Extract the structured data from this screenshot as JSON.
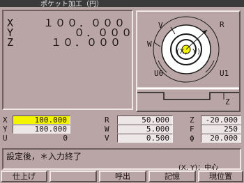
{
  "title": "ポケット加工（円）",
  "position": {
    "x_label": "X",
    "x_value": "１００．０００",
    "y_label": "Y",
    "y_value": "    ０．０００",
    "z_label": "Z",
    "z_value": " １０．０００"
  },
  "diagram": {
    "v_label": "V",
    "r_label": "R",
    "w_label": "W",
    "u0_label": "U0",
    "u1_label": "U1",
    "z_label": "Z",
    "center_label": "(X, Y)"
  },
  "params": {
    "x": {
      "label": "X",
      "value": "100.000"
    },
    "y": {
      "label": "Y",
      "value": "100.000"
    },
    "u": {
      "label": "U",
      "value": "0"
    },
    "r": {
      "label": "R",
      "value": "50.000"
    },
    "w": {
      "label": "W",
      "value": "5.000"
    },
    "v": {
      "label": "V",
      "value": "0.500"
    },
    "z": {
      "label": "Z",
      "value": "-20.000"
    },
    "f": {
      "label": "F",
      "value": "250"
    },
    "phi": {
      "label": "ϕ",
      "value": "20.000"
    }
  },
  "message": {
    "line1": "設定後，＊入力終了",
    "line2": "(X, Y)：中心"
  },
  "buttons": [
    {
      "label": "仕上げ"
    },
    {
      "label": ""
    },
    {
      "label": "呼出"
    },
    {
      "label": "記憶"
    },
    {
      "label": "現位置"
    }
  ],
  "colors": {
    "highlight": "#f4f400",
    "panel": "#b9a5a5",
    "diagram_white": "#ffffff"
  }
}
